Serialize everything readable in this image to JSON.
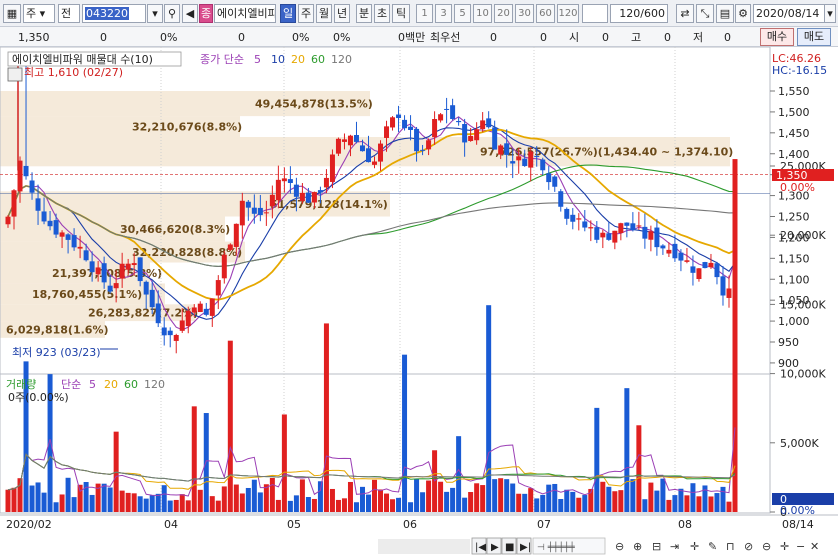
{
  "toolbar": {
    "market_selector": "주",
    "code_selector": "전",
    "stock_code": "043220",
    "stock_name": "에이치엘비파",
    "period_buttons": [
      "일",
      "주",
      "월",
      "년",
      "분",
      "초",
      "틱"
    ],
    "active_period": "일",
    "minute_options": [
      "1",
      "3",
      "5",
      "10",
      "20",
      "30",
      "60",
      "120"
    ],
    "count_display": "120/600",
    "date": "2020/08/14"
  },
  "info_bar": {
    "price": "1,350",
    "change": "0",
    "change_rate": "0%",
    "volume": "0",
    "volume_rate": "0%",
    "trade_amount": "0백만",
    "priority_label": "최우선",
    "priority_value": "0",
    "priority_value2": "0",
    "open_label": "시",
    "open_value": "0",
    "high_label": "고",
    "high_value": "0",
    "low_label": "저",
    "low_value": "0",
    "buy_label": "매수",
    "sell_label": "매도"
  },
  "price_panel": {
    "title": "에이치엘비파워 매물대 수(10)",
    "ma_label": "종가 단순",
    "ma_periods": [
      "5",
      "10",
      "20",
      "60",
      "120"
    ],
    "ma_colors": [
      "#9b3fb5",
      "#1a3ea8",
      "#e6a800",
      "#2d9b2d",
      "#777777"
    ],
    "lc_label": "LC:46.26",
    "hc_label": "HC:-16.15",
    "current_price_label": "1,350",
    "current_rate_label": "0.00%",
    "max_label": "최고 1,610 (02/27)",
    "min_label": "최저 923 (03/23)"
  },
  "volume_panel": {
    "title": "거래량",
    "ma_label": "단순",
    "ma_periods": [
      "5",
      "20",
      "60",
      "120"
    ],
    "ma_colors": [
      "#9b3fb5",
      "#e6a800",
      "#2d9b2d",
      "#777777"
    ],
    "info": "0주(0.00%)",
    "current_volume_label": "0",
    "current_rate_label": "0.00%"
  },
  "x_labels": [
    "2020/02",
    "04",
    "05",
    "06",
    "07",
    "08",
    "08/14"
  ],
  "chart_data": {
    "type": "candlestick",
    "title": "에이치엘비파워",
    "y_ticks": [
      900,
      950,
      1000,
      1050,
      1100,
      1150,
      1200,
      1250,
      1300,
      1350,
      1400,
      1450,
      1500,
      1550
    ],
    "y_range": [
      900,
      1600
    ],
    "volume_ticks": [
      "0",
      "5,000K",
      "10,000K",
      "15,000K",
      "20,000K",
      "25,000K"
    ],
    "volume_range": [
      0,
      27000
    ],
    "volume_profile": [
      {
        "label": "6,029,818(1.6%)"
      },
      {
        "label": "26,283,827(7.2%)"
      },
      {
        "label": "18,760,455(5.1%)"
      },
      {
        "label": "21,397,108(5.8%)"
      },
      {
        "label": "32,220,828(8.8%)"
      },
      {
        "label": "30,466,620(8.3%)"
      },
      {
        "label": "51,579,128(14.1%)"
      },
      {
        "label": "97,726,557(26.7%)(1,434.40 ~ 1,374.10)"
      },
      {
        "label": "32,210,676(8.8%)"
      },
      {
        "label": "49,454,878(13.5%)"
      }
    ]
  }
}
